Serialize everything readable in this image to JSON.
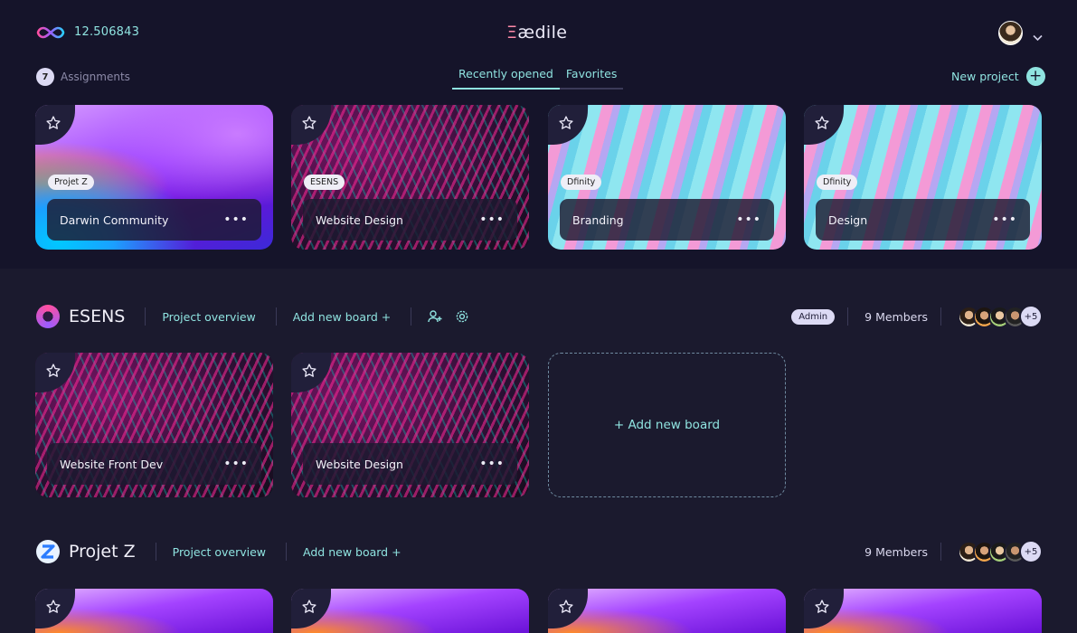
{
  "header": {
    "balance": "12.506843",
    "brand_prefix": "Ξ",
    "brand_text": "ædile"
  },
  "assignments": {
    "count": "7",
    "label": "Assignments"
  },
  "tabs": [
    {
      "label": "Recently opened",
      "active": true
    },
    {
      "label": "Favorites",
      "active": false
    }
  ],
  "new_project_label": "New project",
  "recent_cards": [
    {
      "tag": "Projet Z",
      "title": "Darwin Community"
    },
    {
      "tag": "ESENS",
      "title": "Website Design"
    },
    {
      "tag": "Dfinity",
      "title": "Branding"
    },
    {
      "tag": "Dfinity",
      "title": "Design"
    }
  ],
  "projects": [
    {
      "name": "ESENS",
      "overview_label": "Project overview",
      "add_board_label": "Add new board +",
      "role_badge": "Admin",
      "members_label": "9 Members",
      "more_members": "+5",
      "boards": [
        {
          "title": "Website Front Dev"
        },
        {
          "title": "Website Design"
        }
      ],
      "add_board_card": "+ Add new board"
    },
    {
      "name": "Projet Z",
      "overview_label": "Project overview",
      "add_board_label": "Add new board +",
      "members_label": "9 Members",
      "more_members": "+5"
    }
  ],
  "colors": {
    "accent": "#8fe3e0",
    "background": "#1b1a2e",
    "panel": "#15142a"
  }
}
